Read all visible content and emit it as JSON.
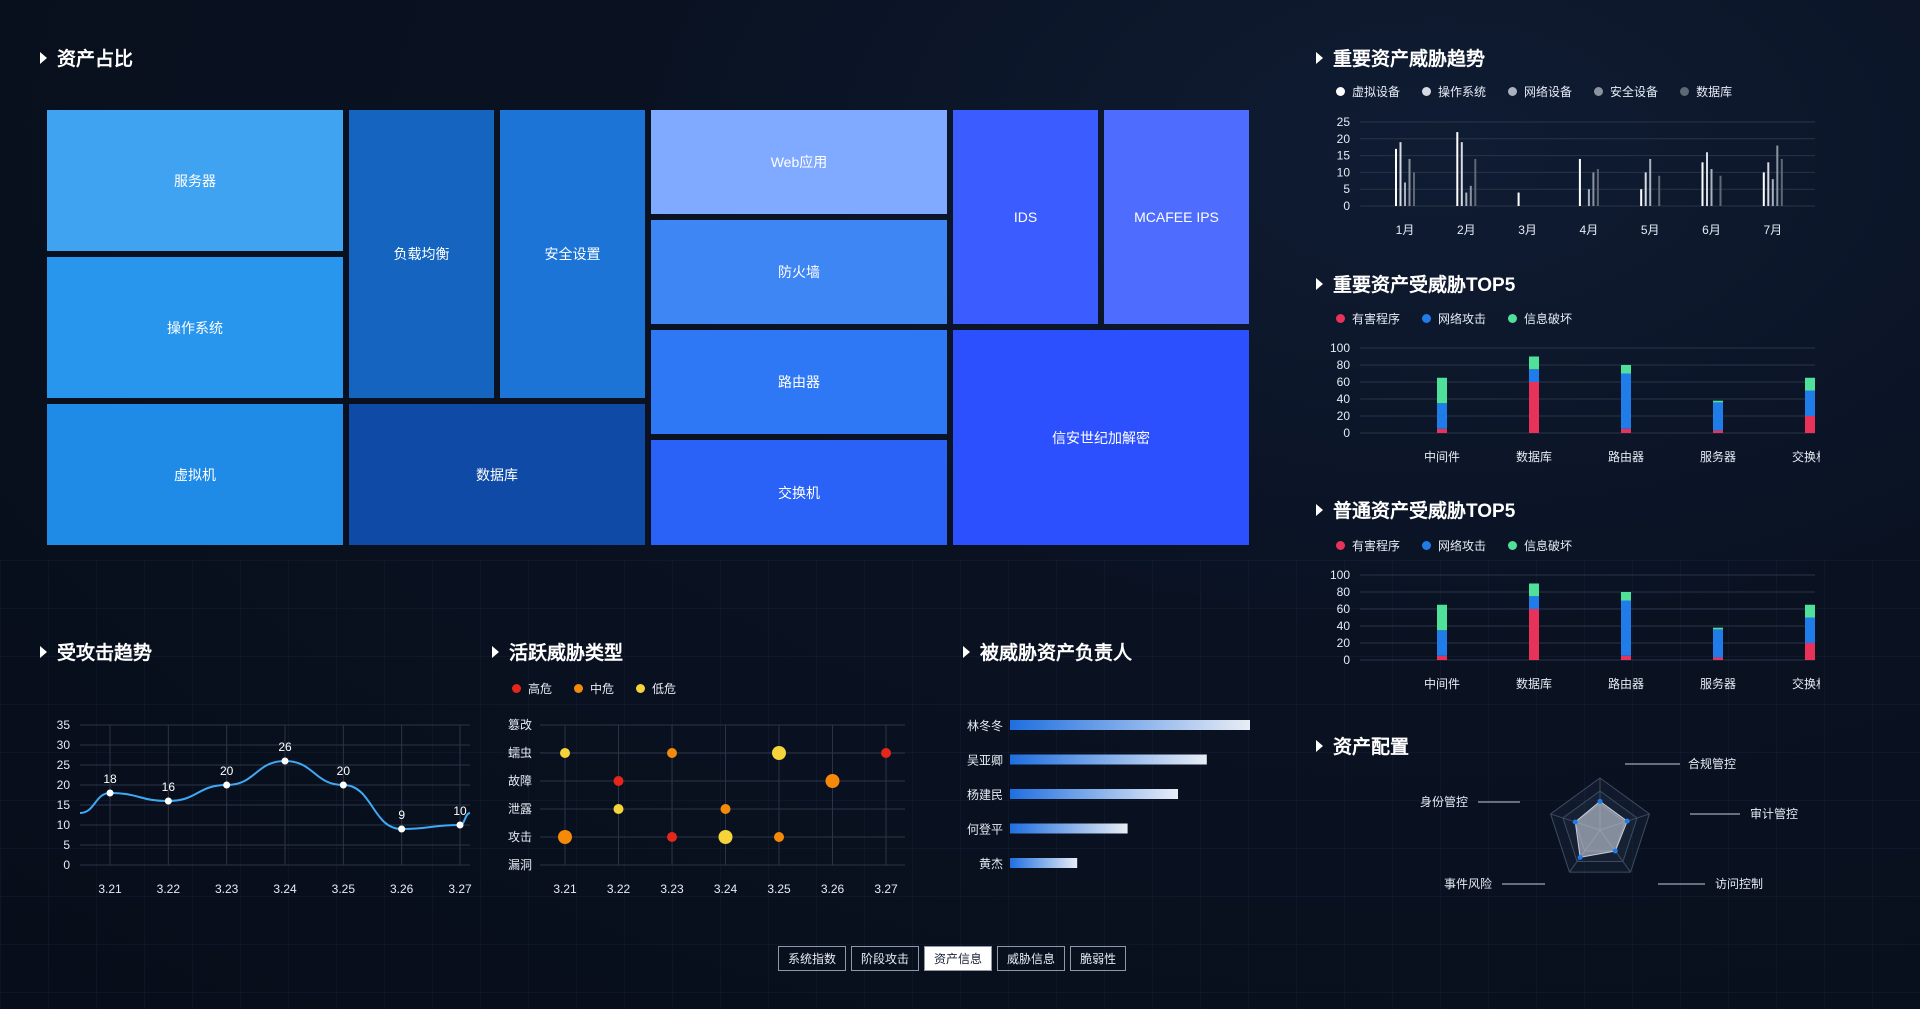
{
  "sections": {
    "asset_ratio": "资产占比",
    "attack_trend": "受攻击趋势",
    "active_threats": "活跃威胁类型",
    "threat_owners": "被威胁资产负责人",
    "important_trend": "重要资产威胁趋势",
    "important_top5": "重要资产受威胁TOP5",
    "normal_top5": "普通资产受威胁TOP5",
    "asset_config": "资产配置"
  },
  "treemap": {
    "tiles": [
      {
        "id": "server",
        "label": "服务器",
        "color": "#3fa3f1"
      },
      {
        "id": "os",
        "label": "操作系统",
        "color": "#2996ee"
      },
      {
        "id": "vm",
        "label": "虚拟机",
        "color": "#1f8be6"
      },
      {
        "id": "lb",
        "label": "负载均衡",
        "color": "#1565c0"
      },
      {
        "id": "sec",
        "label": "安全设置",
        "color": "#1b74d6"
      },
      {
        "id": "db",
        "label": "数据库",
        "color": "#0f4aa6"
      },
      {
        "id": "web",
        "label": "Web应用",
        "color": "#80aaff"
      },
      {
        "id": "fw",
        "label": "防火墙",
        "color": "#3f86f5"
      },
      {
        "id": "router",
        "label": "路由器",
        "color": "#2f78f5"
      },
      {
        "id": "switch",
        "label": "交换机",
        "color": "#2a62f7"
      },
      {
        "id": "ids",
        "label": "IDS",
        "color": "#3b5cff"
      },
      {
        "id": "mcafee",
        "label": "MCAFEE IPS",
        "color": "#4e6dff"
      },
      {
        "id": "xinan",
        "label": "信安世纪加解密",
        "color": "#2d50ff"
      }
    ]
  },
  "attack_trend": {
    "chart_data": {
      "type": "line",
      "categories": [
        "3.21",
        "3.22",
        "3.23",
        "3.24",
        "3.25",
        "3.26",
        "3.27"
      ],
      "values": [
        18,
        16,
        20,
        26,
        20,
        9,
        10
      ],
      "ylim": [
        0,
        35
      ],
      "yticks": [
        0,
        5,
        10,
        15,
        20,
        25,
        30,
        35
      ],
      "color": "#3fa9f5"
    }
  },
  "active_threats": {
    "legend": [
      {
        "name": "高危",
        "color": "#e5261a"
      },
      {
        "name": "中危",
        "color": "#f58a0a"
      },
      {
        "name": "低危",
        "color": "#f5d33a"
      }
    ],
    "chart_data": {
      "type": "scatter",
      "x_categories": [
        "3.21",
        "3.22",
        "3.23",
        "3.24",
        "3.25",
        "3.26",
        "3.27"
      ],
      "y_categories": [
        "漏洞",
        "攻击",
        "泄露",
        "故障",
        "蠕虫",
        "篡改"
      ],
      "points": [
        {
          "x": "3.21",
          "y": "蠕虫",
          "level": "低危",
          "size": 1
        },
        {
          "x": "3.23",
          "y": "蠕虫",
          "level": "中危",
          "size": 1
        },
        {
          "x": "3.25",
          "y": "蠕虫",
          "level": "低危",
          "size": 1.4
        },
        {
          "x": "3.27",
          "y": "蠕虫",
          "level": "高危",
          "size": 1
        },
        {
          "x": "3.22",
          "y": "故障",
          "level": "高危",
          "size": 1
        },
        {
          "x": "3.26",
          "y": "故障",
          "level": "中危",
          "size": 1.4
        },
        {
          "x": "3.22",
          "y": "泄露",
          "level": "低危",
          "size": 1
        },
        {
          "x": "3.24",
          "y": "泄露",
          "level": "中危",
          "size": 1
        },
        {
          "x": "3.21",
          "y": "攻击",
          "level": "中危",
          "size": 1.4
        },
        {
          "x": "3.23",
          "y": "攻击",
          "level": "高危",
          "size": 1
        },
        {
          "x": "3.24",
          "y": "攻击",
          "level": "低危",
          "size": 1.4
        },
        {
          "x": "3.25",
          "y": "攻击",
          "level": "中危",
          "size": 1
        }
      ]
    }
  },
  "threat_owners": {
    "chart_data": {
      "type": "bar",
      "orientation": "horizontal",
      "categories": [
        "林冬冬",
        "吴亚卿",
        "杨建民",
        "何登平",
        "黄杰"
      ],
      "values": [
        100,
        82,
        70,
        49,
        28
      ],
      "xlim": [
        0,
        100
      ]
    }
  },
  "important_trend": {
    "legend": [
      {
        "name": "虚拟设备",
        "color": "#ffffff"
      },
      {
        "name": "操作系统",
        "color": "#d6dbe3"
      },
      {
        "name": "网络设备",
        "color": "#aab2bf"
      },
      {
        "name": "安全设备",
        "color": "#8a93a0"
      },
      {
        "name": "数据库",
        "color": "#5f6874"
      }
    ],
    "chart_data": {
      "type": "bar",
      "categories": [
        "1月",
        "2月",
        "3月",
        "4月",
        "5月",
        "6月",
        "7月"
      ],
      "ylim": [
        0,
        25
      ],
      "yticks": [
        0,
        5,
        10,
        15,
        20,
        25
      ],
      "series": [
        {
          "name": "虚拟设备",
          "values": [
            17,
            22,
            4,
            14,
            5,
            13,
            10
          ]
        },
        {
          "name": "操作系统",
          "values": [
            19,
            19,
            0,
            0,
            10,
            16,
            13
          ]
        },
        {
          "name": "网络设备",
          "values": [
            7,
            4,
            0,
            5,
            14,
            11,
            8
          ]
        },
        {
          "name": "安全设备",
          "values": [
            14,
            6,
            0,
            10,
            0,
            0,
            18
          ]
        },
        {
          "name": "数据库",
          "values": [
            10,
            14,
            0,
            11,
            9,
            9,
            14
          ]
        }
      ]
    }
  },
  "important_top5": {
    "legend": [
      {
        "name": "有害程序",
        "color": "#e8325a"
      },
      {
        "name": "网络攻击",
        "color": "#1f7ce8"
      },
      {
        "name": "信息破坏",
        "color": "#4fe09a"
      }
    ],
    "chart_data": {
      "type": "bar",
      "stacked": true,
      "categories": [
        "中间件",
        "数据库",
        "路由器",
        "服务器",
        "交换机"
      ],
      "ylim": [
        0,
        100
      ],
      "yticks": [
        0,
        20,
        40,
        60,
        80,
        100
      ],
      "series": [
        {
          "name": "有害程序",
          "values": [
            5,
            60,
            5,
            3,
            20
          ]
        },
        {
          "name": "网络攻击",
          "values": [
            30,
            15,
            65,
            33,
            30
          ]
        },
        {
          "name": "信息破坏",
          "values": [
            30,
            15,
            10,
            2,
            15
          ]
        }
      ]
    }
  },
  "normal_top5": {
    "legend": [
      {
        "name": "有害程序",
        "color": "#e8325a"
      },
      {
        "name": "网络攻击",
        "color": "#1f7ce8"
      },
      {
        "name": "信息破坏",
        "color": "#4fe09a"
      }
    ],
    "chart_data": {
      "type": "bar",
      "stacked": true,
      "categories": [
        "中间件",
        "数据库",
        "路由器",
        "服务器",
        "交换机"
      ],
      "ylim": [
        0,
        100
      ],
      "yticks": [
        0,
        20,
        40,
        60,
        80,
        100
      ],
      "series": [
        {
          "name": "有害程序",
          "values": [
            5,
            60,
            5,
            3,
            20
          ]
        },
        {
          "name": "网络攻击",
          "values": [
            30,
            15,
            65,
            33,
            30
          ]
        },
        {
          "name": "信息破坏",
          "values": [
            30,
            15,
            10,
            2,
            15
          ]
        }
      ]
    }
  },
  "asset_config": {
    "chart_data": {
      "type": "radar",
      "indicators": [
        "合规管控",
        "审计管控",
        "访问控制",
        "事件风险",
        "身份管控"
      ],
      "values": [
        0.55,
        0.55,
        0.5,
        0.65,
        0.5
      ]
    }
  },
  "tabs": [
    {
      "label": "系统指数",
      "active": false
    },
    {
      "label": "阶段攻击",
      "active": false
    },
    {
      "label": "资产信息",
      "active": true
    },
    {
      "label": "威胁信息",
      "active": false
    },
    {
      "label": "脆弱性",
      "active": false
    }
  ]
}
